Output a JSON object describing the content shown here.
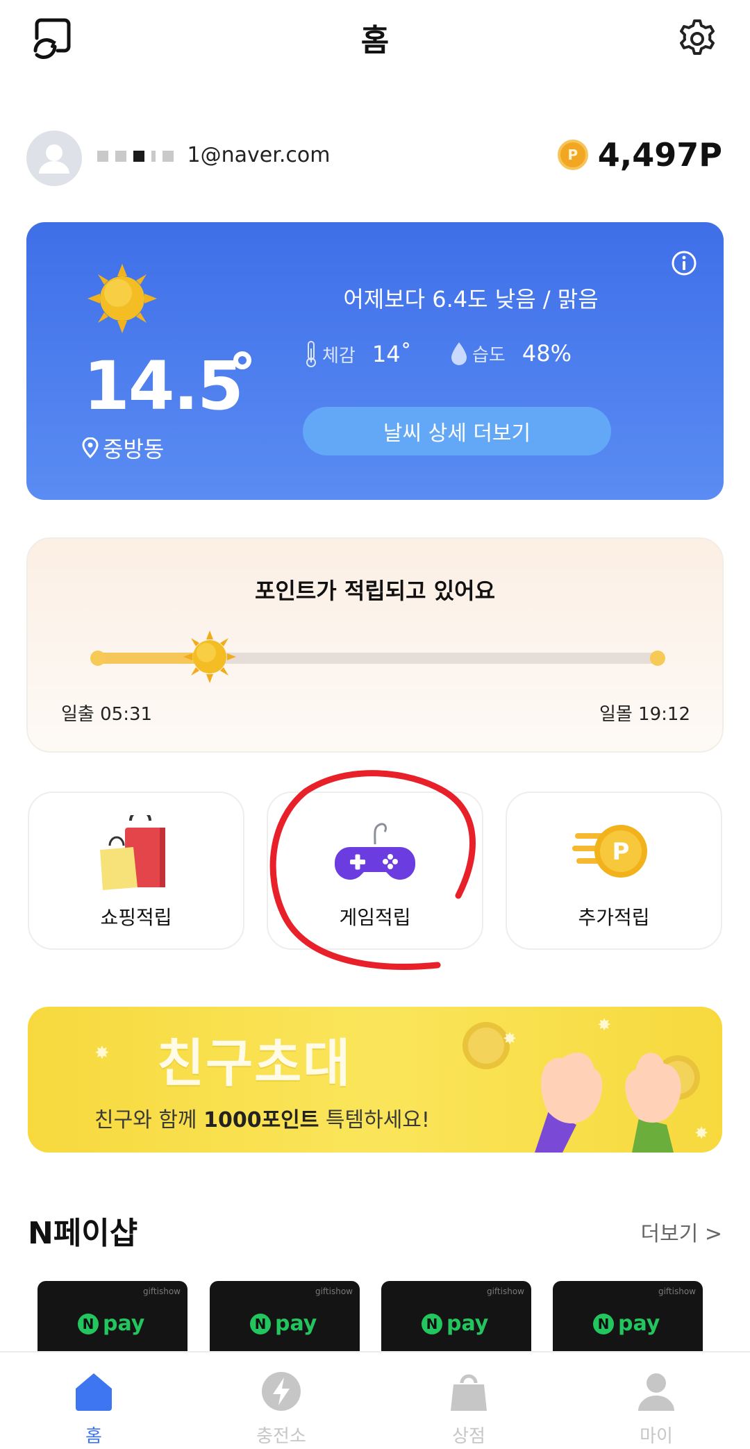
{
  "header": {
    "title": "홈"
  },
  "profile": {
    "email_suffix": "1@naver.com",
    "points": "4,497P",
    "coin_letter": "P"
  },
  "weather": {
    "temperature": "14.5",
    "location": "중방동",
    "summary": "어제보다 6.4도 낮음 / 맑음",
    "feels_label": "체감",
    "feels_value": "14˚",
    "humidity_label": "습도",
    "humidity_value": "48%",
    "detail_button": "날씨 상세 더보기"
  },
  "points_progress": {
    "title": "포인트가 적립되고 있어요",
    "sunrise": "일출 05:31",
    "sunset": "일몰 19:12",
    "progress": 0.2
  },
  "tiles": [
    {
      "label": "쇼핑적립"
    },
    {
      "label": "게임적립"
    },
    {
      "label": "추가적립"
    }
  ],
  "banner": {
    "title": "친구초대",
    "subtitle_pre": "친구와 함께 ",
    "subtitle_bold": "1000포인트",
    "subtitle_post": " 특템하세요!"
  },
  "section": {
    "title": "N페이샵",
    "more": "더보기 >"
  },
  "npay_cards": [
    {
      "brand": "giftishow",
      "n": "N",
      "pay": "pay"
    },
    {
      "brand": "giftishow",
      "n": "N",
      "pay": "pay"
    },
    {
      "brand": "giftishow",
      "n": "N",
      "pay": "pay"
    },
    {
      "brand": "giftishow",
      "n": "N",
      "pay": "pay"
    }
  ],
  "bottom_nav": [
    {
      "label": "홈",
      "icon": "home-icon",
      "active": true
    },
    {
      "label": "충전소",
      "icon": "bolt-icon",
      "active": false
    },
    {
      "label": "상점",
      "icon": "shopping-bag-icon",
      "active": false
    },
    {
      "label": "마이",
      "icon": "person-icon",
      "active": false
    }
  ],
  "colors": {
    "accent": "#3d76f0",
    "weather_top": "#3f6fe8",
    "annotation": "#e8202a"
  }
}
